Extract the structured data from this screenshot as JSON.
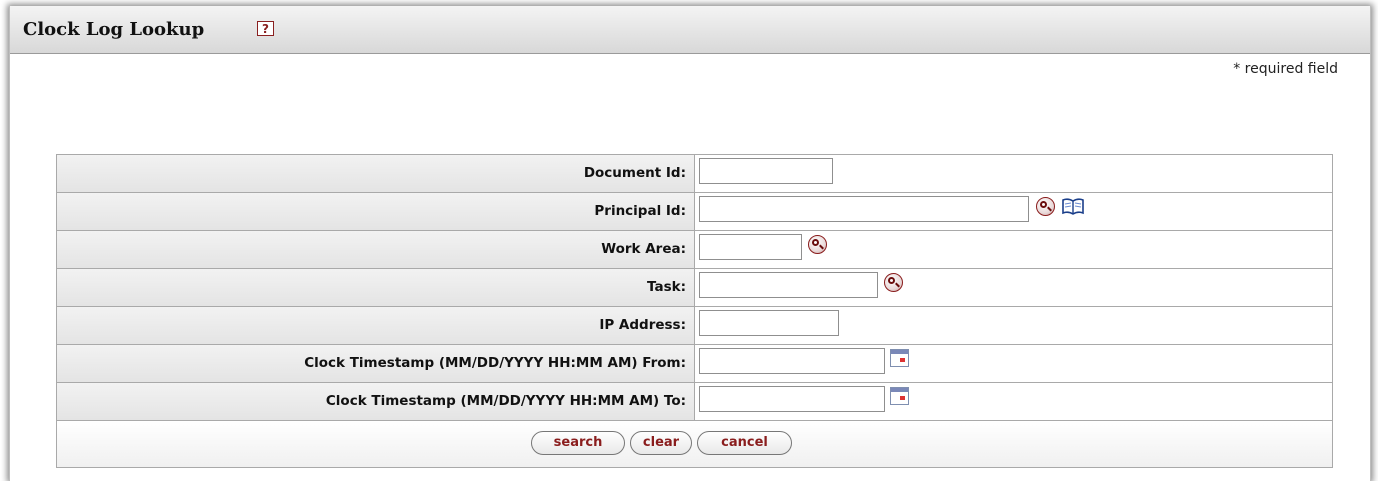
{
  "page": {
    "title": "Clock Log Lookup",
    "help_icon": "help-icon",
    "required_note": "* required field"
  },
  "form": {
    "fields": [
      {
        "label": "Document Id:",
        "value": ""
      },
      {
        "label": "Principal Id:",
        "value": ""
      },
      {
        "label": "Work Area:",
        "value": ""
      },
      {
        "label": "Task:",
        "value": ""
      },
      {
        "label": "IP Address:",
        "value": ""
      },
      {
        "label": "Clock Timestamp (MM/DD/YYYY HH:MM AM) From:",
        "value": ""
      },
      {
        "label": "Clock Timestamp (MM/DD/YYYY HH:MM AM) To:",
        "value": ""
      }
    ],
    "icons": {
      "lookup": "magnifier-lookup-icon",
      "inquiry": "book-inquiry-icon",
      "calendar": "calendar-icon"
    }
  },
  "buttons": {
    "search": "search",
    "clear": "clear",
    "cancel": "cancel"
  },
  "colors": {
    "accent": "#8a1d1d",
    "label_bg": "#e8e8e8",
    "border": "#a9a9a9"
  }
}
